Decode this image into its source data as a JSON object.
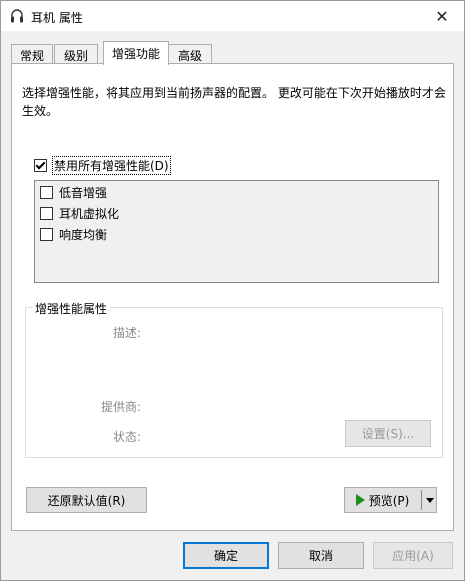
{
  "window": {
    "title": "耳机 属性"
  },
  "tabs": [
    {
      "label": "常规",
      "active": false
    },
    {
      "label": "级别",
      "active": false
    },
    {
      "label": "增强功能",
      "active": true
    },
    {
      "label": "高级",
      "active": false
    }
  ],
  "enhancements": {
    "description": "选择增强性能，将其应用到当前扬声器的配置。 更改可能在下次开始播放时才会生效。",
    "disable_all": {
      "label": "禁用所有增强性能(D)",
      "checked": true
    },
    "items": [
      {
        "label": "低音增强",
        "checked": false
      },
      {
        "label": "耳机虚拟化",
        "checked": false
      },
      {
        "label": "响度均衡",
        "checked": false
      }
    ]
  },
  "properties": {
    "group_title": "增强性能属性",
    "description_label": "描述:",
    "provider_label": "提供商:",
    "status_label": "状态:",
    "settings_button": "设置(S)..."
  },
  "buttons": {
    "restore_defaults": "还原默认值(R)",
    "preview": "预览(P)",
    "ok": "确定",
    "cancel": "取消",
    "apply": "应用(A)"
  },
  "colors": {
    "accent": "#0078d7",
    "play_icon": "#1a8f1a"
  }
}
